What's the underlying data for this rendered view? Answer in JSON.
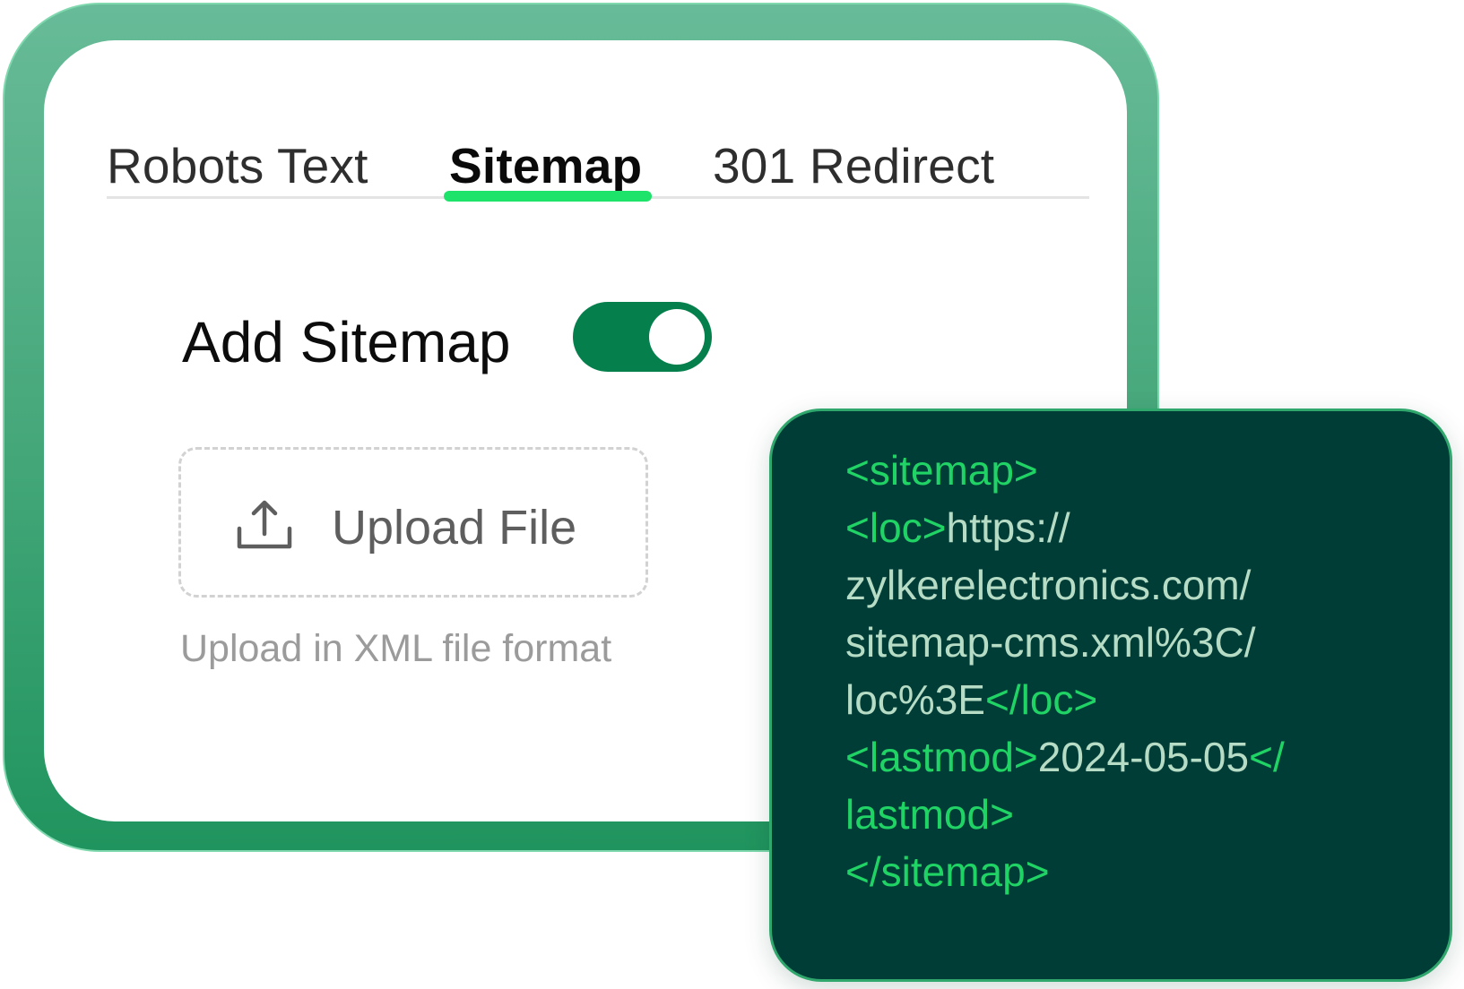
{
  "tabs": [
    {
      "label": "Robots Text",
      "active": false
    },
    {
      "label": "Sitemap",
      "active": true
    },
    {
      "label": "301 Redirect",
      "active": false
    }
  ],
  "sitemap_settings": {
    "add_label": "Add Sitemap",
    "toggle_on": true,
    "upload_label": "Upload File",
    "upload_hint": "Upload in XML file format"
  },
  "code_preview": {
    "line1_tag": "<sitemap>",
    "line2_tag": "<loc>",
    "line2_val": "https://",
    "line3_val": "zylkerelectronics.com/",
    "line4_val": "sitemap-cms.xml%3C/",
    "line5_val": "loc%3E",
    "line5_tag": "</loc>",
    "line6_tag": "<lastmod>",
    "line6_val": "2024-05-05",
    "line6_tag_end": "</",
    "line7_tag": "lastmod>",
    "line8_tag": "</sitemap>"
  },
  "colors": {
    "accent": "#1ee36b",
    "toggle": "#05804d",
    "frame": "#46a87b",
    "code_bg": "#013d37",
    "code_tag": "#20d365"
  }
}
